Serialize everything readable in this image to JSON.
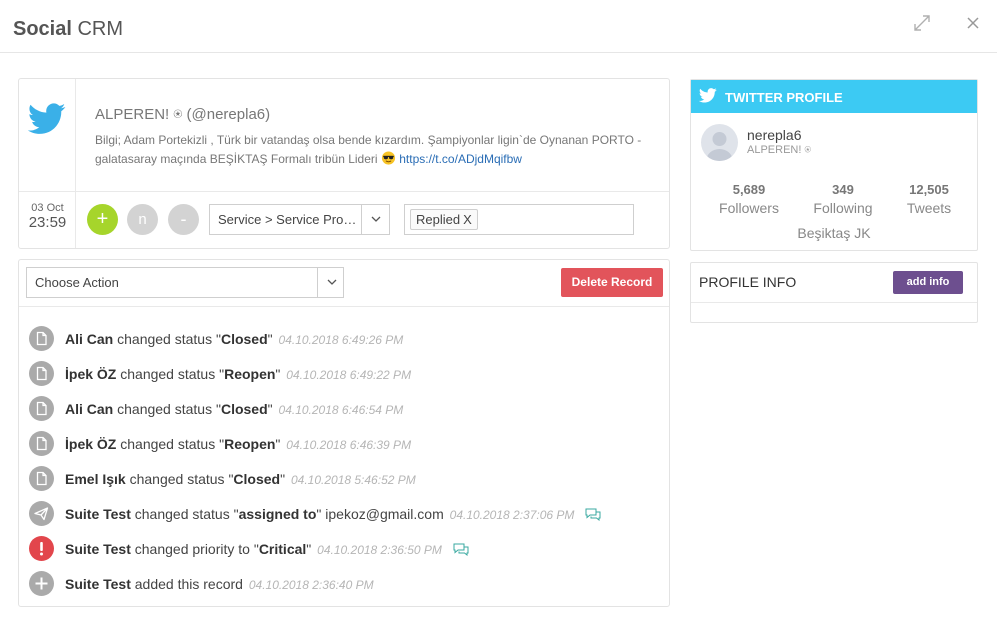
{
  "header": {
    "title_bold": "Social",
    "title_rest": " CRM"
  },
  "tweet": {
    "author": "ALPEREN! ⍟ (@nerepla6)",
    "text": "Bilgi; Adam Portekizli , Türk bir vatandaş olsa bende kızardım. Şampiyonlar ligin`de Oynanan PORTO - galatasaray maçında BEŞİKTAŞ Formalı tribün Lideri ",
    "link": "https://t.co/ADjdMqifbw",
    "date_day": "03 Oct",
    "date_time": "23:59",
    "btn_plus": "+",
    "btn_n": "n",
    "btn_minus": "-",
    "category": "Service > Service Problem",
    "tag": "Replied",
    "tag_remove": "X"
  },
  "actions": {
    "choose_action": "Choose Action",
    "delete_label": "Delete Record"
  },
  "history": [
    {
      "icon": "document-icon",
      "who": "Ali Can",
      "action": " changed status \"",
      "value": "Closed",
      "tail": "\"",
      "extra": "",
      "time": "04.10.2018 6:49:26 PM"
    },
    {
      "icon": "document-icon",
      "who": "İpek ÖZ",
      "action": " changed status \"",
      "value": "Reopen",
      "tail": "\"",
      "extra": "",
      "time": "04.10.2018 6:49:22 PM"
    },
    {
      "icon": "document-icon",
      "who": "Ali Can",
      "action": " changed status \"",
      "value": "Closed",
      "tail": "\"",
      "extra": "",
      "time": "04.10.2018 6:46:54 PM"
    },
    {
      "icon": "document-icon",
      "who": "İpek ÖZ",
      "action": " changed status \"",
      "value": "Reopen",
      "tail": "\"",
      "extra": "",
      "time": "04.10.2018 6:46:39 PM"
    },
    {
      "icon": "document-icon",
      "who": "Emel Işık",
      "action": " changed status \"",
      "value": "Closed",
      "tail": "\"",
      "extra": "",
      "time": "04.10.2018 5:46:52 PM"
    },
    {
      "icon": "send-icon",
      "who": "Suite Test",
      "action": " changed status \"",
      "value": "assigned to",
      "tail": "\"",
      "extra": " ipekoz@gmail.com",
      "time": "04.10.2018 2:37:06 PM"
    },
    {
      "icon": "alert-icon",
      "who": "Suite Test",
      "action": " changed priority to \"",
      "value": "Critical",
      "tail": "\"",
      "extra": "",
      "time": "04.10.2018 2:36:50 PM"
    },
    {
      "icon": "plus-icon",
      "who": "Suite Test",
      "action": " added this record",
      "value": "",
      "tail": "",
      "extra": "",
      "time": "04.10.2018 2:36:40 PM"
    }
  ],
  "profile": {
    "bar_title": "TWITTER PROFILE",
    "username": "nerepla6",
    "display_name": "ALPEREN! ⍟",
    "followers_count": "5,689",
    "followers_label": "Followers",
    "following_count": "349",
    "following_label": "Following",
    "tweets_count": "12,505",
    "tweets_label": "Tweets",
    "location": "Beşiktaş JK"
  },
  "profile_info": {
    "title": "PROFILE INFO",
    "add_label": "add info"
  },
  "colors": {
    "twitter_blue": "#3ccaf3",
    "delete_red": "#e2545b",
    "add_green": "#a6d52b",
    "add_info_purple": "#6d4f8f"
  }
}
